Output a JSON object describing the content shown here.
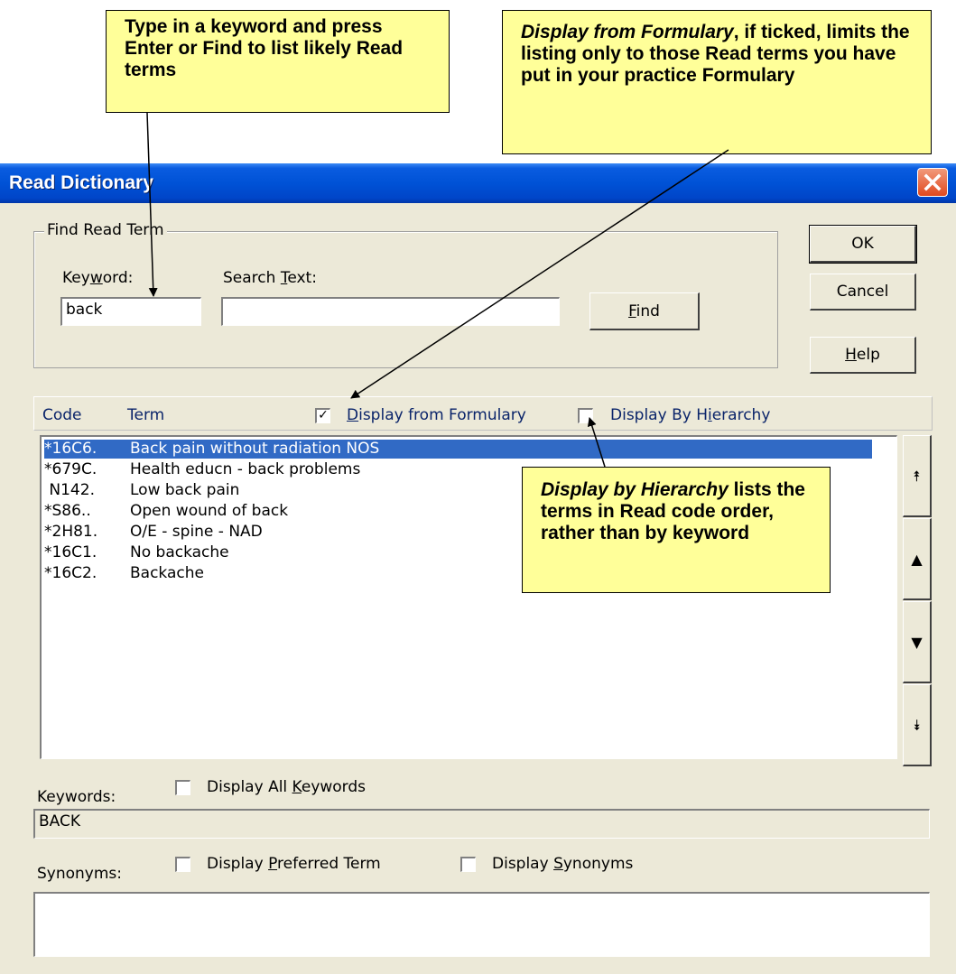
{
  "window": {
    "title": "Read Dictionary"
  },
  "find_group": {
    "title": "Find Read Term",
    "keyword_label": "Keyword:",
    "keyword_value": "back",
    "search_text_label": "Search Text:",
    "search_text_value": "",
    "find_button": "Find"
  },
  "buttons": {
    "ok": "OK",
    "cancel": "Cancel",
    "help": "Help"
  },
  "list_header": {
    "code": "Code",
    "term": "Term",
    "display_from_formulary": "Display from Formulary",
    "display_from_formulary_checked": true,
    "display_by_hierarchy": "Display By Hierarchy",
    "display_by_hierarchy_checked": false
  },
  "rows": [
    {
      "code": "*16C6.",
      "term": "Back pain without radiation NOS",
      "selected": true
    },
    {
      "code": "*679C.",
      "term": "Health educn - back problems"
    },
    {
      "code": " N142.",
      "term": "Low back pain"
    },
    {
      "code": "*S86..",
      "term": "Open wound of back"
    },
    {
      "code": "*2H81.",
      "term": "O/E - spine - NAD"
    },
    {
      "code": "*16C1.",
      "term": "No backache"
    },
    {
      "code": "*16C2.",
      "term": "Backache"
    }
  ],
  "scroll_buttons": {
    "first": "⯭",
    "prev": "▲",
    "next": "▼",
    "last": "⯯"
  },
  "keywords": {
    "label": "Keywords:",
    "display_all": "Display All Keywords",
    "value": "BACK"
  },
  "synonyms": {
    "label": "Synonyms:",
    "display_preferred": "Display Preferred Term",
    "display_synonyms": "Display Synonyms",
    "value": ""
  },
  "callouts": {
    "keyword": "Type in a keyword and press Enter or Find to list likely Read terms",
    "formulary_italic": "Display from Formulary",
    "formulary_rest": ", if ticked, limits the listing only to those Read terms you have put in your practice Formulary",
    "hierarchy_italic": "Display by Hierarchy",
    "hierarchy_rest": " lists the terms in Read code order, rather than by keyword"
  },
  "colors": {
    "callout_bg": "#ffff99",
    "dialog_bg": "#ece9d8",
    "selection": "#316ac5",
    "titlebar": "#0052d6"
  }
}
